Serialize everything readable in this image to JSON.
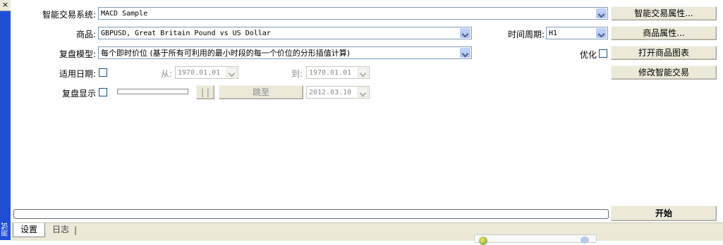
{
  "sidebar": {
    "close_glyph": "×",
    "vertical_label": "测试"
  },
  "expert": {
    "label": "智能交易系统:",
    "value": "MACD Sample",
    "props_button": "智能交易属性..."
  },
  "symbol": {
    "label": "商品:",
    "value": "GBPUSD, Great Britain Pound vs US Dollar",
    "props_button": "商品属性..."
  },
  "period": {
    "label": "时间周期:",
    "value": "H1"
  },
  "model": {
    "label": "复盘模型:",
    "value": "每个即时价位 (基于所有可利用的最小时段的每一个价位的分形插值计算)"
  },
  "optimization": {
    "label": "优化",
    "checked": false
  },
  "open_chart_button": "打开商品图表",
  "modify_expert_button": "修改智能交易",
  "use_date": {
    "label": "适用日期:",
    "checked": false,
    "from_label": "从:",
    "from_value": "1970.01.01",
    "to_label": "到:",
    "to_value": "1970.01.01"
  },
  "visual": {
    "label": "复盘显示",
    "checked": false,
    "pause_button": "| |",
    "skip_button": "跳至",
    "skip_date": "2012.03.10"
  },
  "progress": {
    "fraction": 0
  },
  "start_button": "开始",
  "tabs": [
    {
      "label": "设置",
      "active": true
    },
    {
      "label": "日志",
      "active": false
    }
  ],
  "tab_separator": "|",
  "colors": {
    "sidebar": "#1f4fd6",
    "button_face": "#ece9d8",
    "combo_border": "#7f9db9"
  }
}
